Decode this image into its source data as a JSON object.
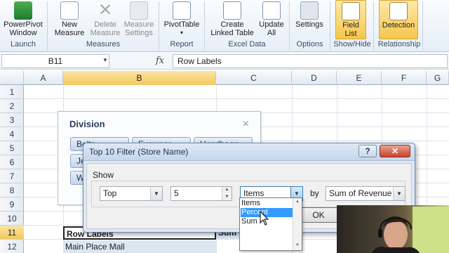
{
  "ribbon": {
    "buttons": [
      {
        "label1": "PowerPivot",
        "label2": "Window",
        "icon": "powerpivot-window-icon",
        "disabled": false,
        "highlight": false
      },
      {
        "label1": "New",
        "label2": "Measure",
        "icon": "new-measure-icon",
        "disabled": false,
        "highlight": false
      },
      {
        "label1": "Delete",
        "label2": "Measure",
        "icon": "delete-measure-icon",
        "disabled": true,
        "highlight": false
      },
      {
        "label1": "Measure",
        "label2": "Settings",
        "icon": "measure-settings-icon",
        "disabled": true,
        "highlight": false
      },
      {
        "label1": "PivotTable",
        "label2": "▾",
        "icon": "pivottable-icon",
        "disabled": false,
        "highlight": false
      },
      {
        "label1": "Create",
        "label2": "Linked Table",
        "icon": "create-linked-table-icon",
        "disabled": false,
        "highlight": false
      },
      {
        "label1": "Update",
        "label2": "All",
        "icon": "update-all-icon",
        "disabled": false,
        "highlight": false
      },
      {
        "label1": "Settings",
        "label2": "",
        "icon": "settings-icon",
        "disabled": false,
        "highlight": false
      },
      {
        "label1": "Field",
        "label2": "List",
        "icon": "field-list-icon",
        "disabled": false,
        "highlight": true
      },
      {
        "label1": "Detection",
        "label2": "",
        "icon": "detection-icon",
        "disabled": false,
        "highlight": true
      }
    ],
    "groups": [
      "Launch",
      "Measures",
      "Report",
      "Excel Data",
      "Options",
      "Show/Hide",
      "Relationship"
    ]
  },
  "formula_bar": {
    "name_box": "B11",
    "fx": "fx",
    "value": "Row Labels"
  },
  "grid": {
    "columns": [
      "A",
      "B",
      "C",
      "D",
      "E",
      "F",
      "G"
    ],
    "rows": [
      "1",
      "2",
      "3",
      "4",
      "5",
      "6",
      "7",
      "8",
      "9",
      "10",
      "11",
      "12"
    ],
    "selected_column": "B",
    "selected_row": "11"
  },
  "slicer": {
    "title": "Division",
    "clear_icon": "clear-filter-icon",
    "items": [
      "Belts",
      "Eyewear",
      "Handbags",
      "Jewelry",
      "Watches"
    ]
  },
  "pivot": {
    "row_labels_header": "Row Labels",
    "first_row": "Main Place Mall",
    "sum_header": "Sum of Revenue"
  },
  "dialog": {
    "title": "Top 10 Filter (Store Name)",
    "help": "?",
    "close": "✕",
    "show_label": "Show",
    "top_bottom": "Top",
    "count": "5",
    "unit": "Items",
    "by_label": "by",
    "by_field": "Sum of Revenue",
    "ok_label": "OK",
    "dropdown_options": [
      "Items",
      "Percent",
      "Sum"
    ],
    "dropdown_highlighted": "Percent"
  }
}
